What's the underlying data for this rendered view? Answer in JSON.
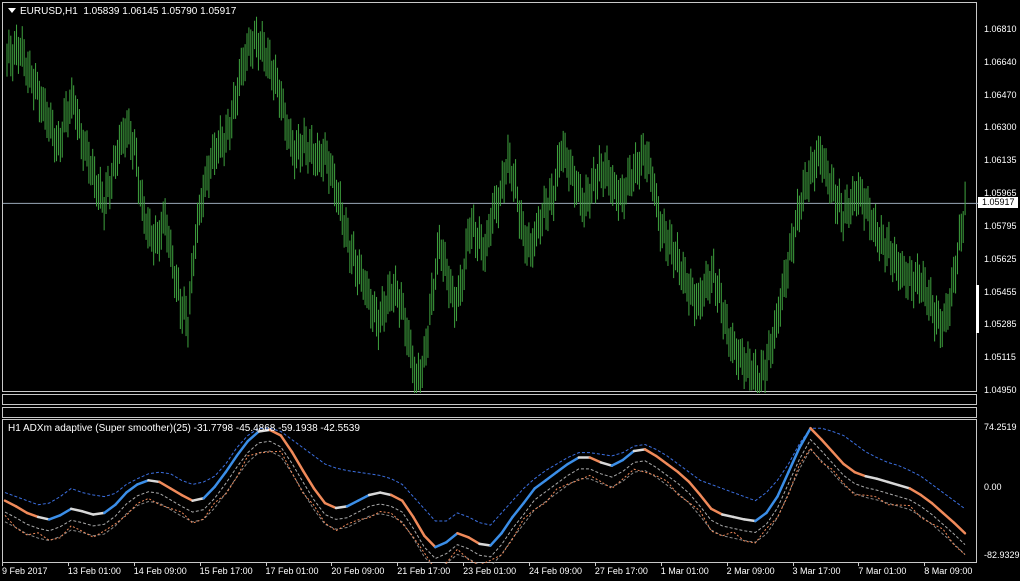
{
  "main_title": "EURUSD,H1  1.05839 1.06145 1.05790 1.05917",
  "indicator_title": "H1 ADXm adaptive (Super smoother)(25) -31.7798 -45.4868 -59.1938 -42.5539",
  "current_price": "1.05917",
  "price_axis": [
    "1.06810",
    "1.06640",
    "1.06470",
    "1.06300",
    "1.06135",
    "1.05965",
    "1.05795",
    "1.05625",
    "1.05455",
    "1.05285",
    "1.05115",
    "1.04950"
  ],
  "indicator_axis": [
    "74.2519",
    "0.00",
    "-82.9329"
  ],
  "time_axis": [
    "9 Feb 2017",
    "13 Feb 01:00",
    "14 Feb 09:00",
    "15 Feb 17:00",
    "17 Feb 01:00",
    "20 Feb 09:00",
    "21 Feb 17:00",
    "23 Feb 01:00",
    "24 Feb 09:00",
    "27 Feb 17:00",
    "1 Mar 01:00",
    "2 Mar 09:00",
    "3 Mar 17:00",
    "7 Mar 01:00",
    "8 Mar 09:00"
  ],
  "colors": {
    "bars": "#3fa33f",
    "up": "#3b8ee8",
    "down": "#f08a5a",
    "neutral": "#d8d8d8",
    "band": "#3b6fe0",
    "level": "#9aa8b8"
  },
  "chart_data": {
    "type": "bar",
    "series_ohlc_close": [
      1.0668,
      1.0672,
      1.066,
      1.0652,
      1.0641,
      1.0632,
      1.062,
      1.0637,
      1.0645,
      1.0625,
      1.0615,
      1.06,
      1.0592,
      1.0605,
      1.0622,
      1.063,
      1.062,
      1.059,
      1.0575,
      1.0572,
      1.0585,
      1.056,
      1.054,
      1.053,
      1.0575,
      1.0598,
      1.0612,
      1.0622,
      1.0625,
      1.064,
      1.066,
      1.0672,
      1.0676,
      1.067,
      1.066,
      1.065,
      1.063,
      1.0617,
      1.0622,
      1.062,
      1.0615,
      1.0616,
      1.0606,
      1.059,
      1.0572,
      1.056,
      1.0552,
      1.054,
      1.053,
      1.054,
      1.0548,
      1.054,
      1.052,
      1.05,
      1.051,
      1.0542,
      1.057,
      1.0556,
      1.054,
      1.055,
      1.058,
      1.0574,
      1.0567,
      1.0587,
      1.0595,
      1.0615,
      1.06,
      1.0575,
      1.0568,
      1.058,
      1.059,
      1.0595,
      1.062,
      1.0612,
      1.06,
      1.059,
      1.06,
      1.0608,
      1.0608,
      1.0598,
      1.0595,
      1.0605,
      1.061,
      1.0618,
      1.0604,
      1.058,
      1.0572,
      1.0565,
      1.0555,
      1.0545,
      1.054,
      1.055,
      1.0555,
      1.054,
      1.0522,
      1.0515,
      1.051,
      1.0505,
      1.05,
      1.051,
      1.0525,
      1.0545,
      1.0565,
      1.0585,
      1.06,
      1.061,
      1.0618,
      1.0605,
      1.0595,
      1.0585,
      1.0592,
      1.0598,
      1.059,
      1.058,
      1.0572,
      1.0568,
      1.056,
      1.0555,
      1.0552,
      1.0552,
      1.0545,
      1.0535,
      1.0528,
      1.054,
      1.0565,
      1.0591
    ],
    "indicator": {
      "ylim": [
        -82.9329,
        74.2519
      ],
      "main_line": [
        -15,
        -22,
        -30,
        -35,
        -38,
        -33,
        -25,
        -28,
        -32,
        -30,
        -20,
        -5,
        5,
        10,
        8,
        0,
        -8,
        -15,
        -12,
        2,
        20,
        40,
        58,
        70,
        72,
        65,
        45,
        22,
        0,
        -18,
        -24,
        -22,
        -15,
        -8,
        -5,
        -8,
        -15,
        -35,
        -58,
        -72,
        -66,
        -55,
        -60,
        -68,
        -70,
        -55,
        -35,
        -18,
        0,
        10,
        20,
        30,
        38,
        38,
        32,
        28,
        35,
        46,
        48,
        40,
        30,
        20,
        8,
        -8,
        -25,
        -32,
        -35,
        -38,
        -40,
        -30,
        -10,
        20,
        50,
        74,
        60,
        45,
        30,
        20,
        15,
        12,
        8,
        4,
        0,
        -8,
        -18,
        -30,
        -42,
        -55
      ],
      "band_upper": [
        -5,
        -10,
        -15,
        -20,
        -18,
        -10,
        0,
        -5,
        -8,
        -10,
        -6,
        5,
        12,
        18,
        20,
        18,
        10,
        5,
        8,
        15,
        30,
        50,
        65,
        74,
        74,
        70,
        60,
        50,
        40,
        30,
        25,
        22,
        20,
        18,
        16,
        12,
        5,
        -10,
        -25,
        -40,
        -40,
        -30,
        -35,
        -42,
        -45,
        -30,
        -15,
        0,
        12,
        22,
        30,
        38,
        44,
        44,
        42,
        40,
        44,
        52,
        54,
        48,
        40,
        30,
        20,
        10,
        5,
        0,
        -5,
        -10,
        -15,
        -5,
        10,
        30,
        55,
        74,
        74,
        70,
        65,
        55,
        45,
        38,
        32,
        28,
        22,
        15,
        5,
        -5,
        -15,
        -25
      ]
    }
  }
}
